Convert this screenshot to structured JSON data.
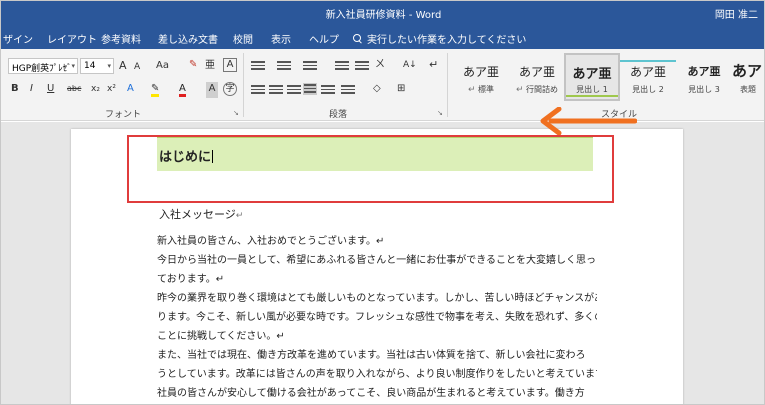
{
  "window": {
    "title": "新入社員研修資料 - Word",
    "user": "岡田 准二"
  },
  "tabs": {
    "design": "ザイン",
    "layout": "レイアウト",
    "references": "参考資料",
    "mailings": "差し込み文書",
    "review": "校閲",
    "view": "表示",
    "help": "ヘルプ",
    "tell_me": "実行したい作業を入力してください"
  },
  "ribbon": {
    "font_name": "HGP創英ｱﾟﾚｲｽﾞ",
    "font_name_visible": "HGP創英ﾌﾟﾚｾﾞ",
    "font_size": "14",
    "font_group_label": "フォント",
    "paragraph_group_label": "段落",
    "styles_group_label": "スタイル",
    "btn_grow": "A",
    "btn_shrink": "A",
    "btn_case": "Aa",
    "btn_bold": "B",
    "btn_italic": "I",
    "btn_underline": "U",
    "btn_strike": "abc",
    "btn_sub": "x₂",
    "btn_sup": "x²",
    "btn_fontcolor": "A",
    "btn_charshade": "A",
    "btn_sort": "A↓",
    "btn_showmarks": "↵",
    "launcher_glyph": "↘"
  },
  "styles": [
    {
      "sample": "あア亜",
      "name": "標準",
      "prefix": "↵"
    },
    {
      "sample": "あア亜",
      "name": "行間詰め",
      "prefix": "↵"
    },
    {
      "sample": "あア亜",
      "name": "見出し 1"
    },
    {
      "sample": "あア亜",
      "name": "見出し 2"
    },
    {
      "sample": "あア亜",
      "name": "見出し 3"
    },
    {
      "sample": "あア",
      "name": "表題"
    }
  ],
  "document": {
    "heading1": "はじめに",
    "subheading": "入社メッセージ",
    "para_mark": "↵",
    "lines": [
      "新入社員の皆さん、入社おめでとうございます。↵",
      "今日から当社の一員として、希望にあふれる皆さんと一緒にお仕事ができることを大変嬉しく思っ",
      "ております。↵",
      "昨今の業界を取り巻く環境はとても厳しいものとなっています。しかし、苦しい時ほどチャンスがあ",
      "ります。今こそ、新しい風が必要な時です。フレッシュな感性で物事を考え、失敗を恐れず、多くの",
      "ことに挑戦してください。↵",
      "また、当社では現在、働き方改革を進めています。当社は古い体質を捨て、新しい会社に変わろ",
      "うとしています。改革には皆さんの声を取り入れながら、より良い制度作りをしたいと考えています。↵",
      "社員の皆さんが安心して働ける会社があってこそ、良い商品が生まれると考えています。働き方"
    ]
  },
  "colors": {
    "ribbon_blue": "#2b579a",
    "heading_fill": "#dcefb8",
    "highlight_box": "#e03c3c",
    "arrow": "#f07020"
  }
}
